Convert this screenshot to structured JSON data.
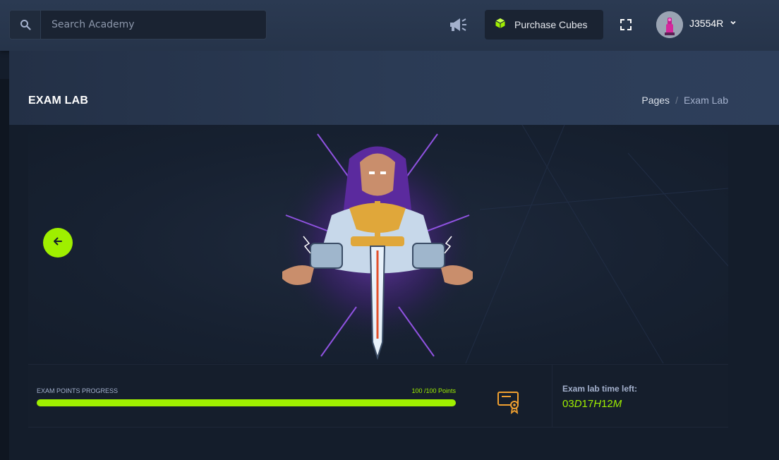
{
  "topbar": {
    "search": {
      "placeholder": "Search Academy"
    },
    "purchase_label": "Purchase Cubes",
    "username": "J3554R"
  },
  "page_header": {
    "title": "EXAM LAB",
    "breadcrumb": [
      "Pages",
      "/",
      "Exam Lab"
    ]
  },
  "stats": {
    "progress_label": "EXAM POINTS PROGRESS",
    "progress_value": "100 /100 Points",
    "progress_fraction": 1.0,
    "time_label": "Exam lab time left:",
    "time_parts": [
      "03",
      "D",
      "17",
      "H",
      "12",
      "M"
    ]
  },
  "colors": {
    "accent": "#9fef00",
    "background": "#141d2b",
    "topbar": "#2b3a52",
    "muted_text": "#a4b1cd"
  },
  "icons": [
    "search-icon",
    "megaphone-icon",
    "cube-icon",
    "fullscreen-icon",
    "chevron-down-icon",
    "arrow-left-icon",
    "certificate-icon"
  ]
}
